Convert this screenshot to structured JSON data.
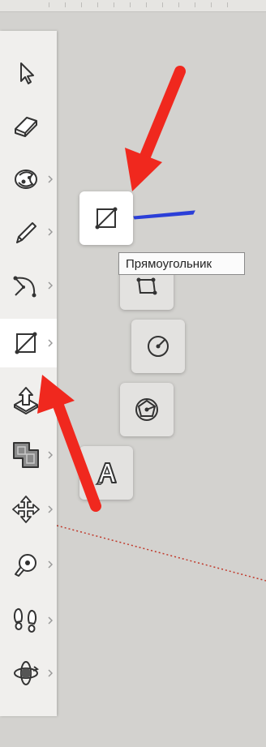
{
  "tooltip": {
    "text": "Прямоугольник"
  },
  "toolbar": {
    "tools": [
      {
        "name": "select",
        "icon": "arrow-cursor-icon",
        "has_flyout": false
      },
      {
        "name": "eraser",
        "icon": "eraser-icon",
        "has_flyout": false
      },
      {
        "name": "paint-bucket",
        "icon": "paint-bucket-icon",
        "has_flyout": true
      },
      {
        "name": "line",
        "icon": "pencil-icon",
        "has_flyout": true
      },
      {
        "name": "arc",
        "icon": "arc-icon",
        "has_flyout": true
      },
      {
        "name": "rectangle",
        "icon": "rectangle-icon",
        "has_flyout": true,
        "active": true
      },
      {
        "name": "push-pull",
        "icon": "push-pull-icon",
        "has_flyout": true
      },
      {
        "name": "offset",
        "icon": "offset-icon",
        "has_flyout": true
      },
      {
        "name": "move",
        "icon": "move-icon",
        "has_flyout": true
      },
      {
        "name": "tape-measure",
        "icon": "tape-measure-icon",
        "has_flyout": true
      },
      {
        "name": "walk",
        "icon": "footprints-icon",
        "has_flyout": true
      },
      {
        "name": "orbit",
        "icon": "orbit-icon",
        "has_flyout": true
      }
    ]
  },
  "flyout": {
    "items": [
      {
        "name": "rectangle",
        "icon": "rectangle-icon",
        "selected": true
      },
      {
        "name": "rotated-rectangle",
        "icon": "rotated-rectangle-icon"
      },
      {
        "name": "circle",
        "icon": "circle-icon"
      },
      {
        "name": "polygon",
        "icon": "polygon-icon"
      },
      {
        "name": "3d-text",
        "icon": "3d-text-icon"
      }
    ]
  },
  "colors": {
    "arrow": "#f0281e",
    "toolbar_bg": "#f0efed",
    "canvas_bg": "#d3d2cf",
    "axis_red": "#c0392b",
    "axis_blue": "#2b3fd8"
  }
}
